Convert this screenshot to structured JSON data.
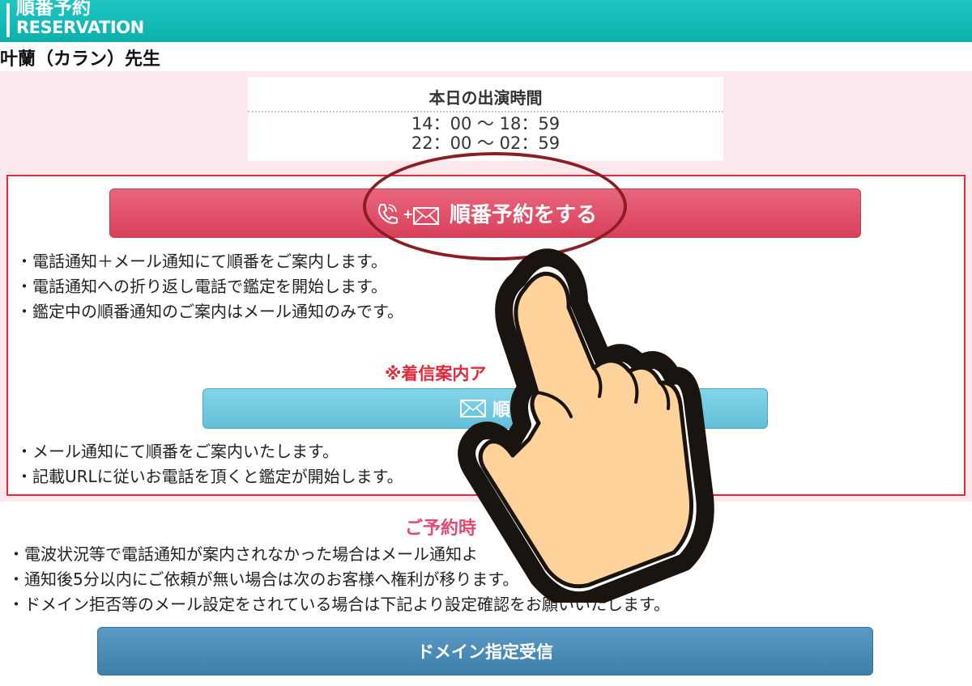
{
  "header": {
    "title_jp": "順番予約",
    "title_en": "RESERVATION"
  },
  "teacher_name": "叶蘭（カラン）先生",
  "schedule": {
    "title": "本日の出演時間",
    "times": [
      "14：00 〜 18：59",
      "22：00 〜 02：59"
    ]
  },
  "phone_reserve": {
    "button_label": "順番予約をする",
    "notes": [
      "・電話通知＋メール通知にて順番をご案内します。",
      "・電話通知への折り返し電話で鑑定を開始します。",
      "・鑑定中の順番通知のご案内はメール通知のみです。"
    ]
  },
  "mail_reserve": {
    "warning": "※着信案内ア",
    "button_label": "順",
    "notes": [
      "・メール通知にて順番をご案内いたします。",
      "・記載URLに従いお電話を頂くと鑑定が開始します。"
    ]
  },
  "reserve_notes": {
    "title": "ご予約時",
    "items": [
      "・電波状況等で電話通知が案内されなかった場合はメール通知よ",
      "・通知後5分以内にご依頼が無い場合は次のお客様へ権利が移ります。",
      "・ドメイン拒否等のメール設定をされている場合は下記より設定確認をお願いいたします。"
    ]
  },
  "domain_button": "ドメイン指定受信",
  "colors": {
    "header": "#0bb0ab",
    "red_button": "#d9405a",
    "blue_button": "#62bfd9",
    "domain_button": "#3f7ea8",
    "pink_bg": "#fde8ee",
    "accent_red": "#e02a3a"
  }
}
